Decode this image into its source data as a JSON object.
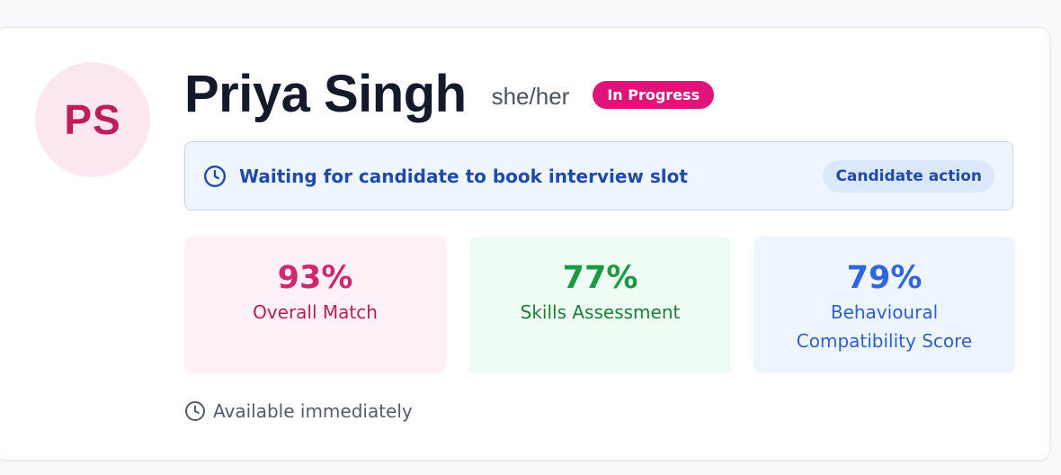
{
  "candidate": {
    "initials": "PS",
    "name": "Priya Singh",
    "pronouns": "she/her",
    "status_badge": "In Progress"
  },
  "status_banner": {
    "icon": "clock-icon",
    "message": "Waiting for candidate to book interview slot",
    "chip": "Candidate action"
  },
  "metrics": [
    {
      "value": "93%",
      "label": "Overall Match",
      "color": "#d0286e"
    },
    {
      "value": "77%",
      "label": "Skills Assessment",
      "color": "#1a9a43"
    },
    {
      "value": "79%",
      "label_line1": "Behavioural",
      "label_line2": "Compatibility Score",
      "color": "#2f66dd"
    }
  ],
  "availability": {
    "icon": "clock-icon",
    "text": "Available immediately"
  },
  "colors": {
    "badge": "#e0137a",
    "avatar_bg": "#fce7f1",
    "avatar_text": "#be1f5c",
    "banner_bg": "#eef5ff",
    "banner_text": "#1f4aa8"
  }
}
